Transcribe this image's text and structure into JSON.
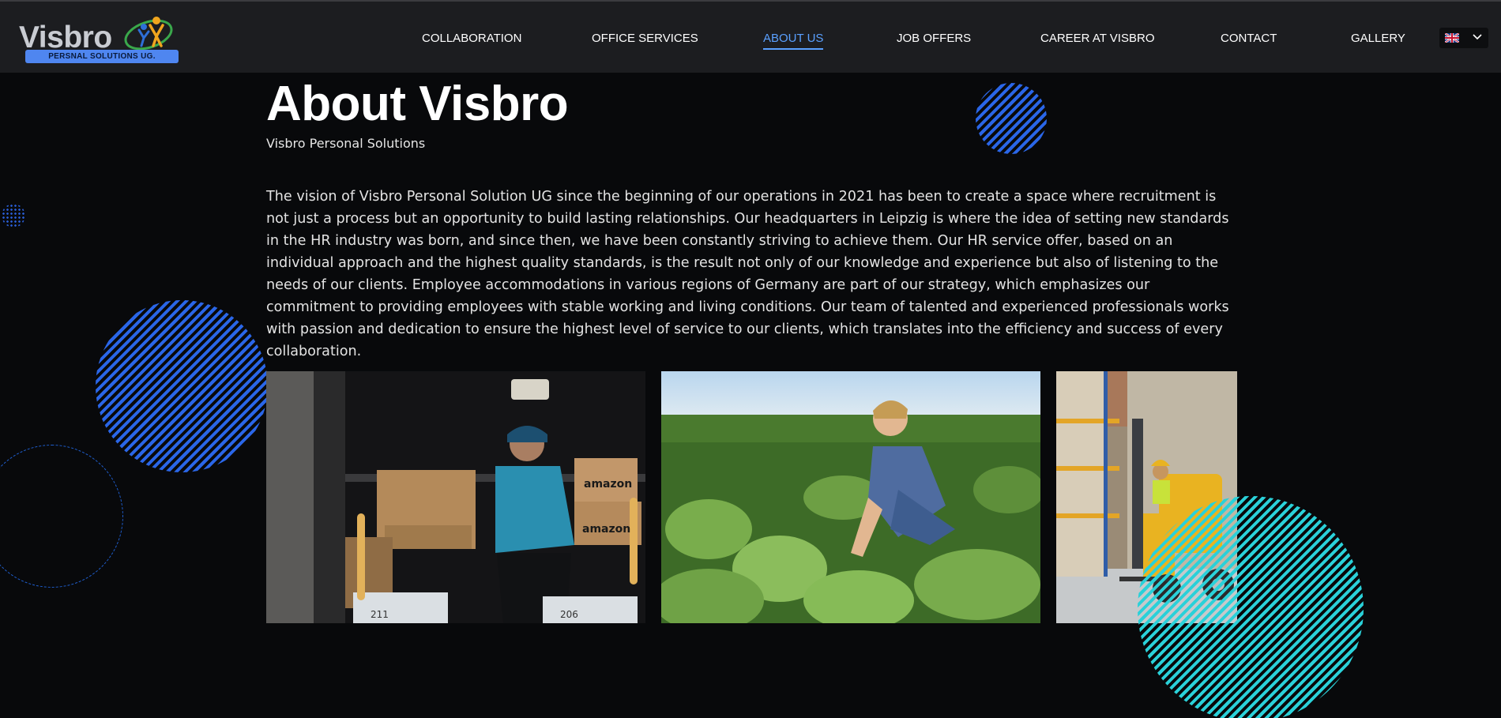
{
  "brand": {
    "name": "Visbro",
    "tagline": "PERSNAL SOLUTIONS UG."
  },
  "nav": {
    "items": [
      {
        "label": "COLLABORATION"
      },
      {
        "label": "OFFICE SERVICES"
      },
      {
        "label": "ABOUT US",
        "active": true
      },
      {
        "label": "JOB OFFERS"
      },
      {
        "label": "CAREER AT VISBRO"
      },
      {
        "label": "CONTACT"
      },
      {
        "label": "GALLERY"
      }
    ],
    "language": {
      "flag": "uk-flag-icon",
      "dropdown_icon": "chevron-down-icon"
    }
  },
  "page": {
    "title": "About Visbro",
    "subtitle": "Visbro Personal Solutions",
    "body": "The vision of Visbro Personal Solution UG since the beginning of our operations in 2021 has been to create a space where recruitment is not just a process but an opportunity to build lasting relationships. Our headquarters in Leipzig is where the idea of setting new standards in the HR industry was born, and since then, we have been constantly striving to achieve them. Our HR service offer, based on an individual approach and the highest quality standards, is the result not only of our knowledge and experience but also of listening to the needs of our clients. Employee accommodations in various regions of Germany are part of our strategy, which emphasizes our commitment to providing employees with stable working and living conditions. Our team of talented and experienced professionals works with passion and dedication to ensure the highest level of service to our clients, which translates into the efficiency and success of every collaboration."
  },
  "photos": {
    "van": {
      "box_label": "amazon",
      "bag_numbers": [
        "211",
        "206"
      ]
    },
    "farm": {},
    "forklift": {}
  },
  "colors": {
    "background": "#08090b",
    "header": "#1c1d20",
    "accent_blue": "#5aa0ff",
    "stripe_blue": "#2a66e8",
    "stripe_cyan": "#2ad1d9"
  }
}
